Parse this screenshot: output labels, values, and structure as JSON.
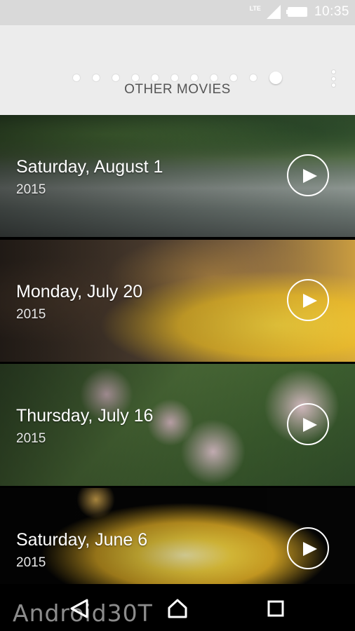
{
  "status_bar": {
    "network": "LTE",
    "time": "10:35"
  },
  "header": {
    "pager": {
      "total": 11,
      "active_index": 10
    },
    "section_title": "OTHER MOVIES"
  },
  "movies": [
    {
      "date": "Saturday, August 1",
      "year": "2015"
    },
    {
      "date": "Monday, July 20",
      "year": "2015"
    },
    {
      "date": "Thursday, July 16",
      "year": "2015"
    },
    {
      "date": "Saturday, June 6",
      "year": "2015"
    }
  ],
  "nav_bar": {
    "back_icon": "back-triangle-icon",
    "home_icon": "home-icon",
    "recents_icon": "recents-square-icon"
  },
  "watermark": "Android30T"
}
